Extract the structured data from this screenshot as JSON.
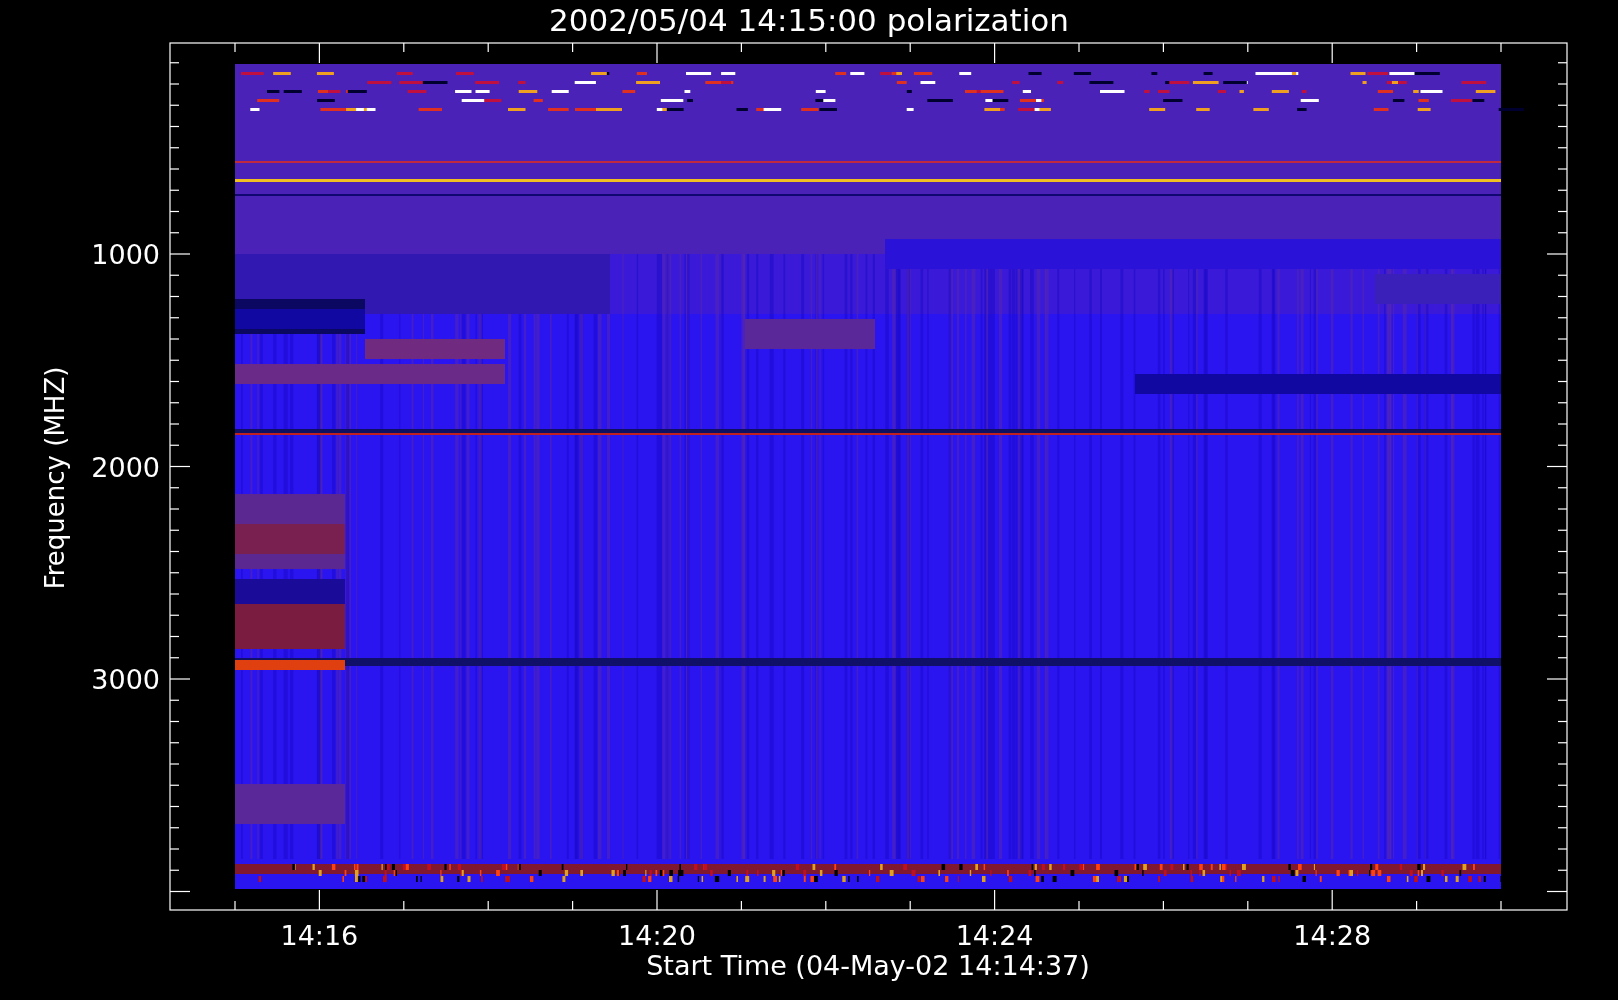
{
  "title": "2002/05/04 14:15:00 polarization",
  "plot": {
    "ylabel": "Frequency (MHZ)",
    "xlabel": "Start Time (04-May-02 14:14:37)",
    "yticks": [
      "1000",
      "2000",
      "3000"
    ],
    "xticks": [
      "14:16",
      "14:20",
      "14:24",
      "14:28"
    ]
  }
}
